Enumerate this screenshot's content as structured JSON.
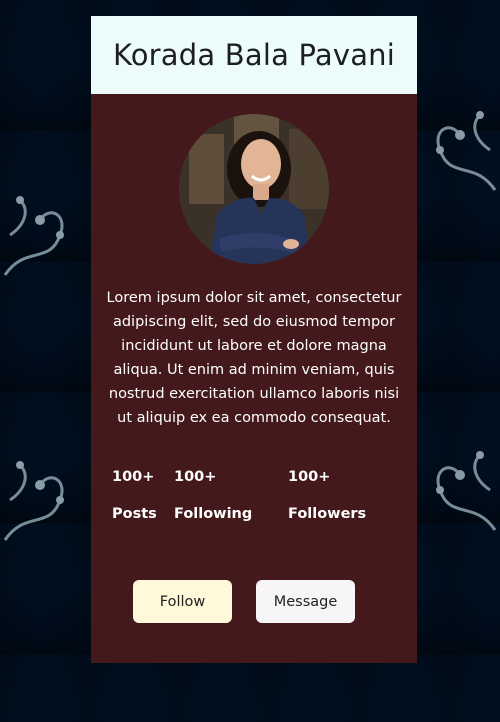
{
  "profile": {
    "name": "Korada Bala Pavani",
    "bio": "Lorem ipsum dolor sit amet, consectetur adipiscing elit, sed do eiusmod tempor incididunt ut labore et dolore magna aliqua. Ut enim ad minim veniam, quis nostrud exercitation ullamco laboris nisi ut aliquip ex ea commodo consequat.",
    "avatar_icon": "profile-photo"
  },
  "stats": {
    "posts": {
      "count": "100+",
      "label": "Posts"
    },
    "following": {
      "count": "100+",
      "label": "Following"
    },
    "followers": {
      "count": "100+",
      "label": "Followers"
    }
  },
  "actions": {
    "follow_label": "Follow",
    "message_label": "Message"
  },
  "colors": {
    "card_background": "#43191b",
    "header_background": "#ecfcfd",
    "follow_button": "#fff8d9",
    "message_button": "#f7f5f7",
    "page_background": "#0b3a55"
  }
}
